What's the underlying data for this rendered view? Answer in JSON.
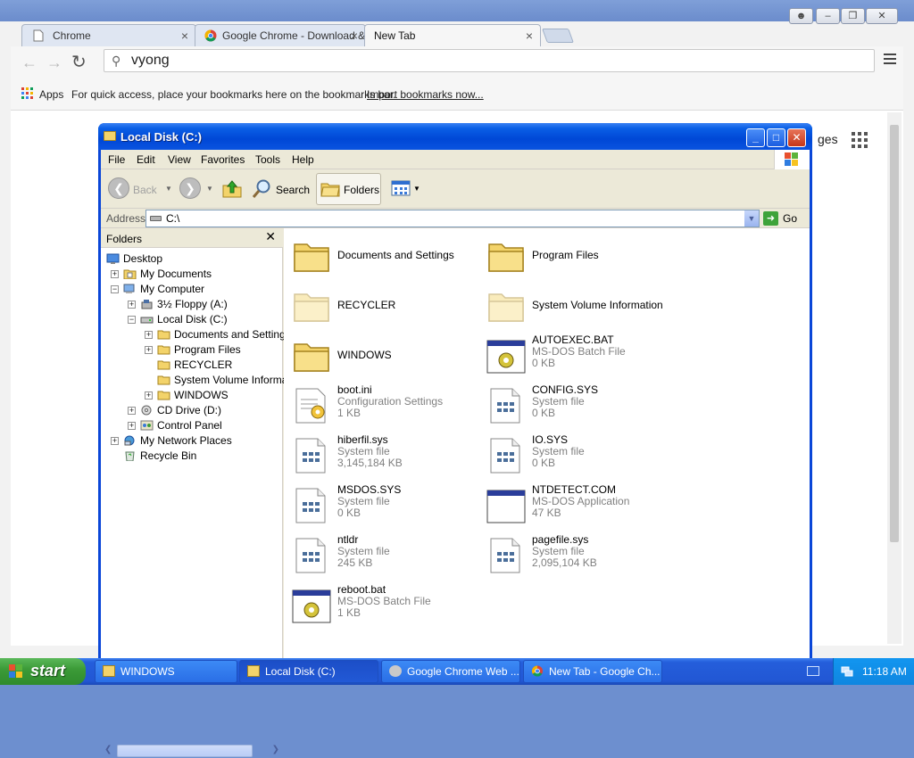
{
  "chrome": {
    "tabs": [
      {
        "label": "Chrome",
        "close": "×"
      },
      {
        "label": "Google Chrome - Download &",
        "close": "×"
      },
      {
        "label": "New Tab",
        "close": "×"
      }
    ],
    "omnibox_value": "vyong",
    "bookmarks": {
      "apps_label": "Apps",
      "hint": "For quick access, place your bookmarks here on the bookmarks bar.",
      "import_link": "Import bookmarks now..."
    },
    "page_fragment": "ges"
  },
  "explorer": {
    "title": "Local Disk (C:)",
    "menu": [
      "File",
      "Edit",
      "View",
      "Favorites",
      "Tools",
      "Help"
    ],
    "toolbar": {
      "back": "Back",
      "search": "Search",
      "folders": "Folders"
    },
    "address": {
      "label": "Address",
      "value": "C:\\",
      "go": "Go"
    },
    "tree": {
      "header": "Folders",
      "items": [
        {
          "label": "Desktop"
        },
        {
          "label": "My Documents"
        },
        {
          "label": "My Computer"
        },
        {
          "label": "3½ Floppy (A:)"
        },
        {
          "label": "Local Disk (C:)"
        },
        {
          "label": "Documents and Settings"
        },
        {
          "label": "Program Files"
        },
        {
          "label": "RECYCLER"
        },
        {
          "label": "System Volume Informati"
        },
        {
          "label": "WINDOWS"
        },
        {
          "label": "CD Drive (D:)"
        },
        {
          "label": "Control Panel"
        },
        {
          "label": "My Network Places"
        },
        {
          "label": "Recycle Bin"
        }
      ]
    },
    "files": [
      {
        "name": "Documents and Settings",
        "type": "",
        "size": "",
        "icon": "folder-icon"
      },
      {
        "name": "Program Files",
        "type": "",
        "size": "",
        "icon": "folder-icon"
      },
      {
        "name": "RECYCLER",
        "type": "",
        "size": "",
        "icon": "hidden-folder-icon"
      },
      {
        "name": "System Volume Information",
        "type": "",
        "size": "",
        "icon": "hidden-folder-icon"
      },
      {
        "name": "WINDOWS",
        "type": "",
        "size": "",
        "icon": "folder-icon"
      },
      {
        "name": "AUTOEXEC.BAT",
        "type": "MS-DOS Batch File",
        "size": "0 KB",
        "icon": "batch-file-icon"
      },
      {
        "name": "boot.ini",
        "type": "Configuration Settings",
        "size": "1 KB",
        "icon": "config-file-icon"
      },
      {
        "name": "CONFIG.SYS",
        "type": "System file",
        "size": "0 KB",
        "icon": "system-file-icon"
      },
      {
        "name": "hiberfil.sys",
        "type": "System file",
        "size": "3,145,184 KB",
        "icon": "system-file-icon"
      },
      {
        "name": "IO.SYS",
        "type": "System file",
        "size": "0 KB",
        "icon": "system-file-icon"
      },
      {
        "name": "MSDOS.SYS",
        "type": "System file",
        "size": "0 KB",
        "icon": "system-file-icon"
      },
      {
        "name": "NTDETECT.COM",
        "type": "MS-DOS Application",
        "size": "47 KB",
        "icon": "dos-app-icon"
      },
      {
        "name": "ntldr",
        "type": "System file",
        "size": "245 KB",
        "icon": "system-file-icon"
      },
      {
        "name": "pagefile.sys",
        "type": "System file",
        "size": "2,095,104 KB",
        "icon": "system-file-icon"
      },
      {
        "name": "reboot.bat",
        "type": "MS-DOS Batch File",
        "size": "1 KB",
        "icon": "batch-file-icon"
      }
    ]
  },
  "taskbar": {
    "start": "start",
    "tasks": [
      {
        "label": "WINDOWS"
      },
      {
        "label": "Local Disk (C:)"
      },
      {
        "label": "Google Chrome Web ..."
      },
      {
        "label": "New Tab - Google Ch..."
      }
    ],
    "clock": "11:18 AM"
  },
  "colors": {
    "xp_title_blue": "#0a46d8",
    "xp_start_green": "#3c9b38",
    "folder_yellow": "#f3d36a"
  }
}
